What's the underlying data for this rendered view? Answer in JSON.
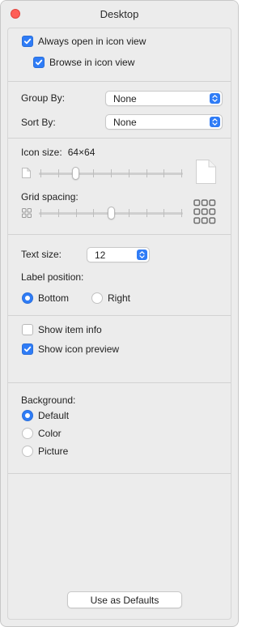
{
  "window": {
    "title": "Desktop"
  },
  "view_options": {
    "always_open_label": "Always open in icon view",
    "always_open_checked": true,
    "browse_label": "Browse in icon view",
    "browse_checked": true
  },
  "group_by": {
    "label": "Group By:",
    "value": "None"
  },
  "sort_by": {
    "label": "Sort By:",
    "value": "None"
  },
  "icon_size": {
    "label": "Icon size:",
    "value_text": "64×64",
    "level_fraction": 0.24
  },
  "grid_spacing": {
    "label": "Grid spacing:",
    "level_fraction": 0.5
  },
  "text_size": {
    "label": "Text size:",
    "value": "12"
  },
  "label_position": {
    "label": "Label position:",
    "options": [
      {
        "label": "Bottom",
        "selected": true
      },
      {
        "label": "Right",
        "selected": false
      }
    ]
  },
  "show_options": {
    "item_info_label": "Show item info",
    "item_info_checked": false,
    "icon_preview_label": "Show icon preview",
    "icon_preview_checked": true
  },
  "background": {
    "label": "Background:",
    "options": [
      {
        "label": "Default",
        "selected": true
      },
      {
        "label": "Color",
        "selected": false
      },
      {
        "label": "Picture",
        "selected": false
      }
    ]
  },
  "footer": {
    "defaults_button": "Use as Defaults"
  },
  "colors": {
    "accent": "#2f7cf6",
    "close": "#fe5f57"
  }
}
